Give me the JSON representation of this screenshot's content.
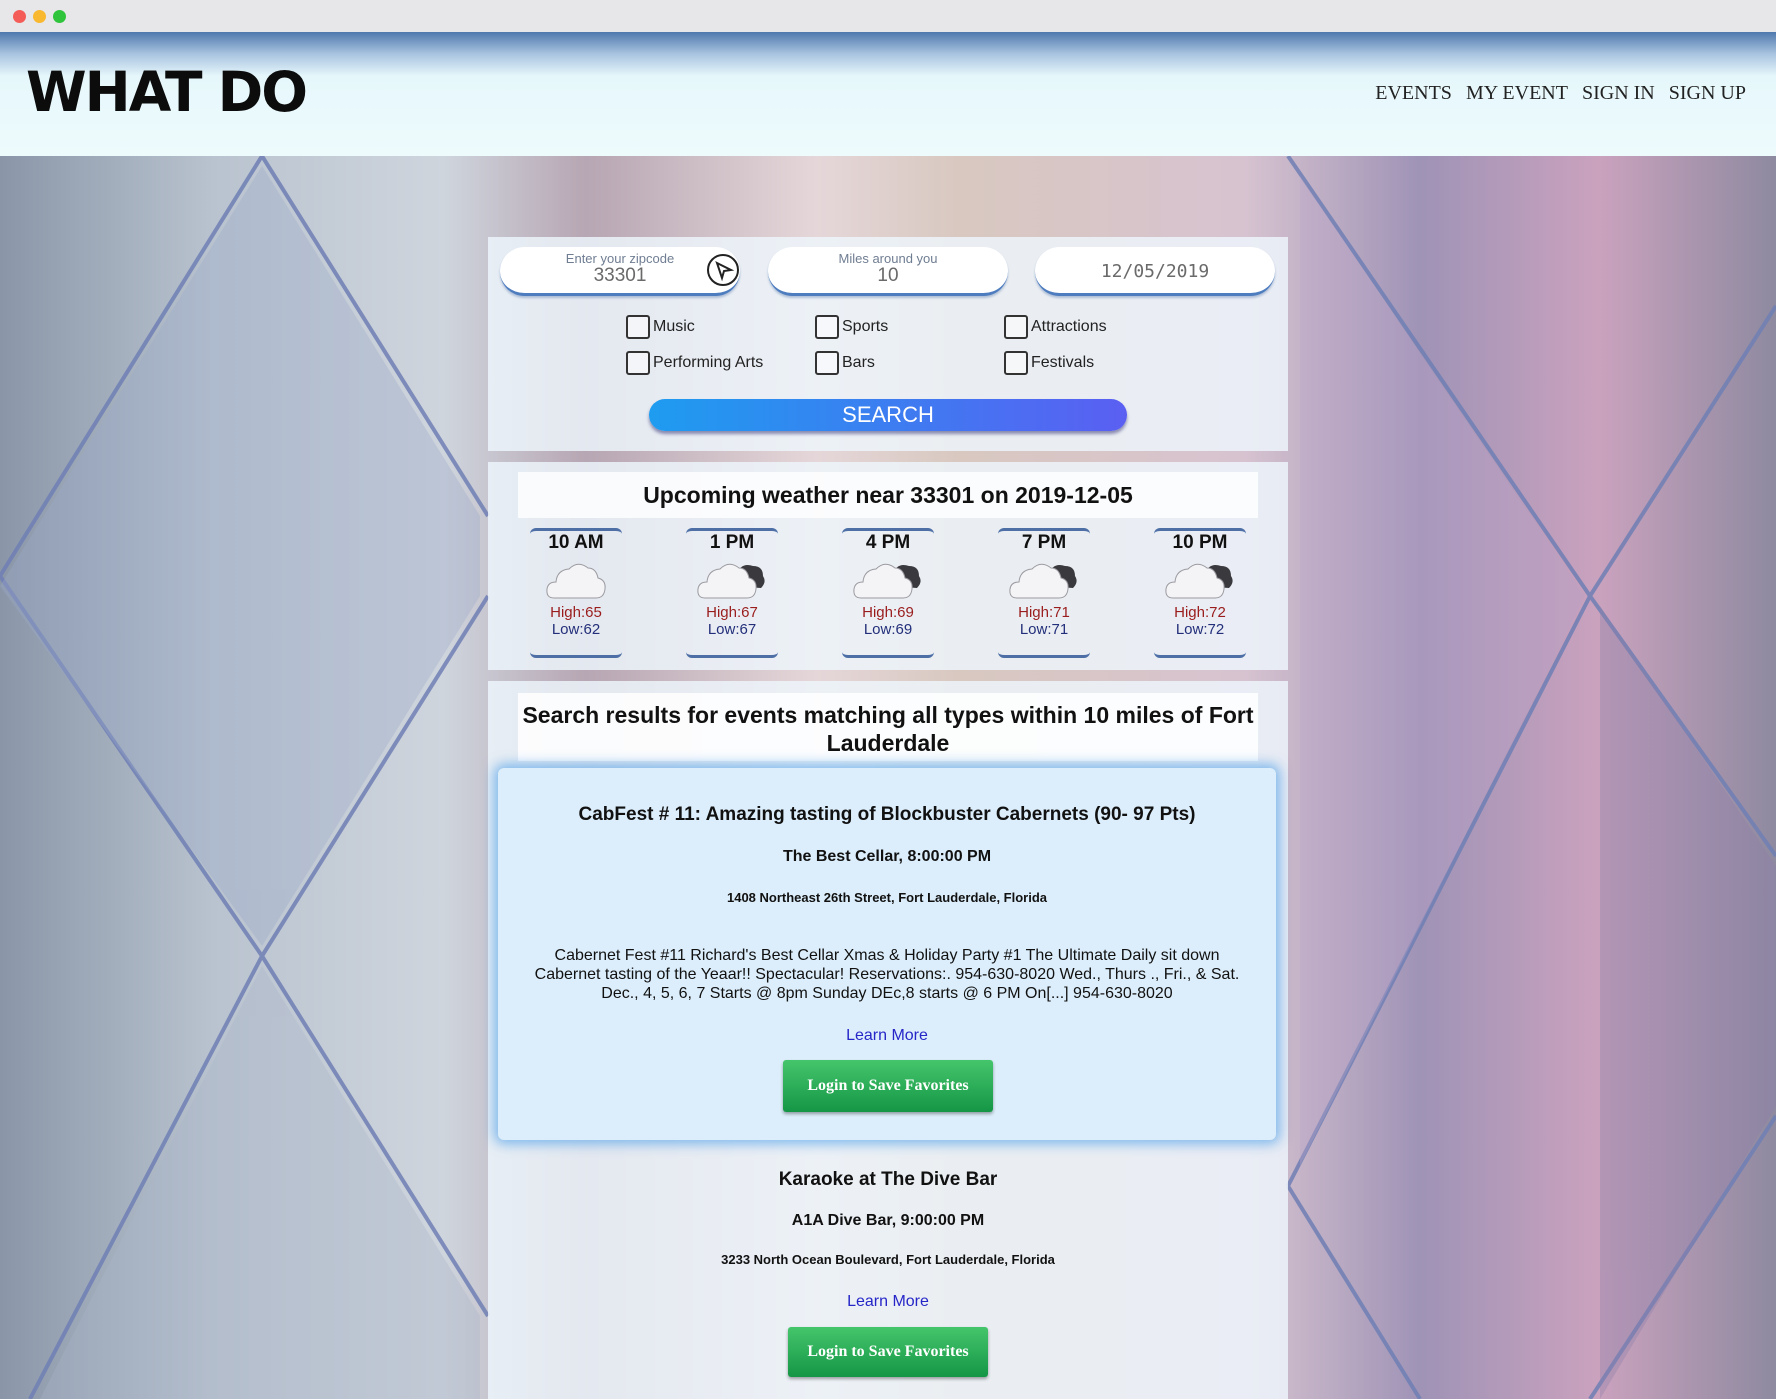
{
  "header": {
    "logo": "WHAT DO",
    "nav": [
      "EVENTS",
      "MY EVENT",
      "SIGN IN",
      "SIGN UP"
    ]
  },
  "search": {
    "zip_label": "Enter your zipcode",
    "zip_value": "33301",
    "miles_label": "Miles around you",
    "miles_value": "10",
    "date_value": "12/05/2019",
    "categories": [
      "Music",
      "Sports",
      "Attractions",
      "Performing Arts",
      "Bars",
      "Festivals"
    ],
    "search_label": "SEARCH"
  },
  "weather": {
    "title": "Upcoming weather near 33301 on 2019-12-05",
    "hours": [
      {
        "time": "10 AM",
        "icon": "cloud-icon",
        "high": "High:65",
        "low": "Low:62"
      },
      {
        "time": "1 PM",
        "icon": "cloudy-icon",
        "high": "High:67",
        "low": "Low:67"
      },
      {
        "time": "4 PM",
        "icon": "cloudy-icon",
        "high": "High:69",
        "low": "Low:69"
      },
      {
        "time": "7 PM",
        "icon": "cloudy-icon",
        "high": "High:71",
        "low": "Low:71"
      },
      {
        "time": "10 PM",
        "icon": "cloudy-icon",
        "high": "High:72",
        "low": "Low:72"
      }
    ]
  },
  "results": {
    "title": "Search results for events matching all types within 10 miles of Fort Lauderdale",
    "events": [
      {
        "name": "CabFest # 11: Amazing tasting of Blockbuster Cabernets (90- 97 Pts)",
        "venue": "The Best Cellar, 8:00:00 PM",
        "address": "1408 Northeast 26th Street, Fort Lauderdale, Florida",
        "description": "Cabernet Fest #11     Richard's Best Cellar Xmas & Holiday Party #1    The Ultimate Daily sit down Cabernet tasting of the Yeaar!! Spectacular! Reservations:. 954-630-8020 Wed., Thurs ., Fri., & Sat. Dec., 4, 5, 6, 7 Starts @ 8pm Sunday DEc,8 starts @ 6 PM On[...] 954-630-8020",
        "learn_more": "Learn More",
        "save": "Login to Save Favorites"
      },
      {
        "name": "Karaoke at The Dive Bar",
        "venue": "A1A Dive Bar, 9:00:00 PM",
        "address": "3233 North Ocean Boulevard, Fort Lauderdale, Florida",
        "learn_more": "Learn More",
        "save": "Login to Save Favorites"
      }
    ]
  },
  "colors": {
    "accent": "#4d7cbf",
    "search_gradient_start": "#1e9cf0",
    "search_gradient_end": "#5a5ff2",
    "save_button": "#1e9f4c",
    "high_temp": "#9a1d1d",
    "low_temp": "#232f7a",
    "link": "#2626c8"
  }
}
